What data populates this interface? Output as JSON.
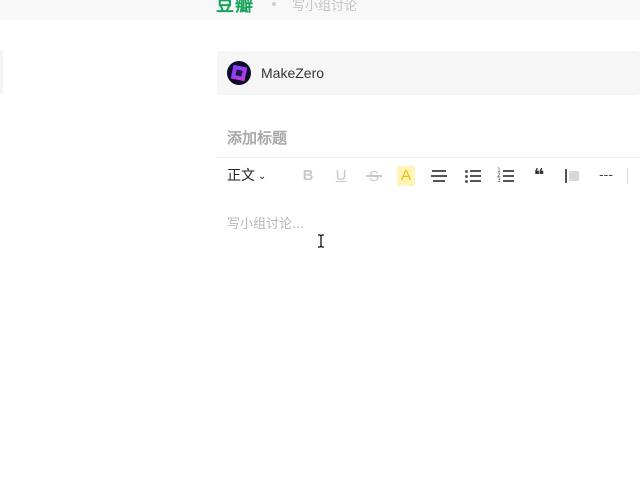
{
  "header": {
    "brand": "豆瓣",
    "breadcrumb": "写小组讨论"
  },
  "group": {
    "name": "MakeZero",
    "avatar_icon": "makezero-logo"
  },
  "editor": {
    "title_placeholder": "添加标题",
    "body_placeholder": "写小组讨论...",
    "toolbar": {
      "paragraph_style": "正文",
      "bold": "B",
      "underline": "U",
      "strikethrough": "S",
      "highlight": "A",
      "quote": "❝",
      "divider": "---",
      "icons": [
        "chevron-down-icon",
        "bold-icon",
        "underline-icon",
        "strikethrough-icon",
        "highlight-icon",
        "align-center-icon",
        "bullet-list-icon",
        "numbered-list-icon",
        "quote-icon",
        "code-block-icon",
        "horizontal-rule-icon"
      ]
    }
  },
  "colors": {
    "brand": "#1aa35b",
    "highlight_bg": "#fff3b8",
    "placeholder": "#b5b5b5"
  }
}
